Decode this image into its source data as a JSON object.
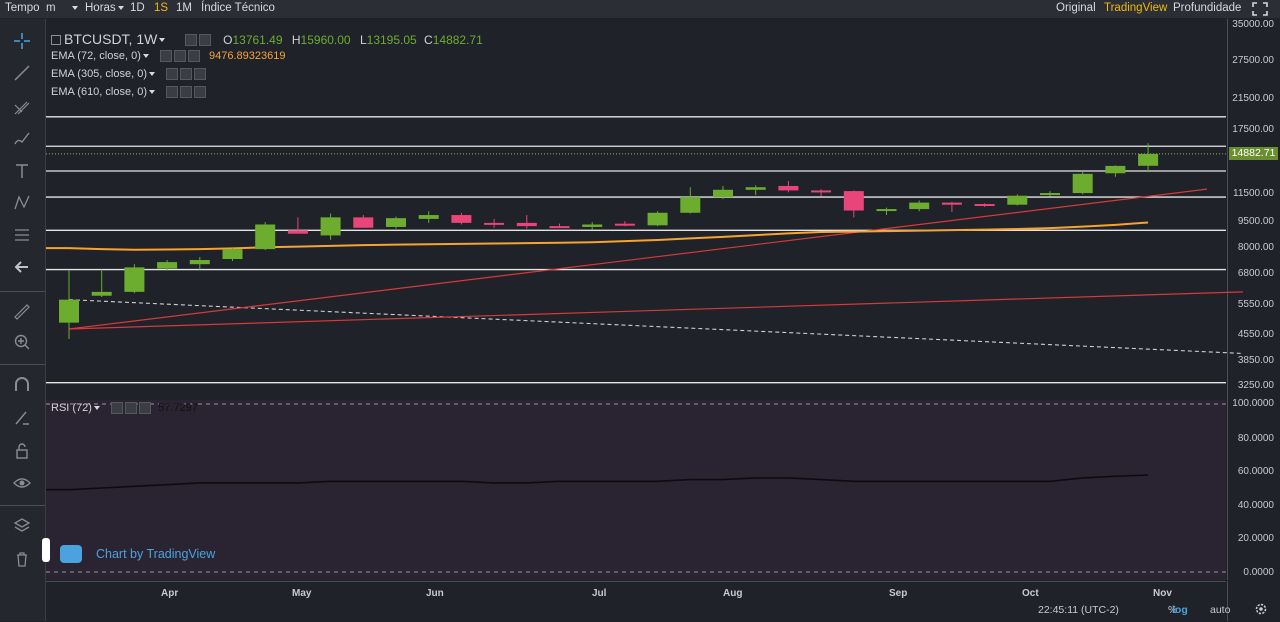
{
  "topbar": {
    "tempo": "Tempo",
    "minutes": "m",
    "hours": "Horas",
    "d1": "1D",
    "s1": "1S",
    "m1": "1M",
    "indicators": "Índice Técnico",
    "original": "Original",
    "tradingview": "TradingView",
    "depth": "Profundidade",
    "active_interval": "1S",
    "active_view": "TradingView"
  },
  "symbol": {
    "name": "BTCUSDT, 1W",
    "open_label": "O",
    "open": "13761.49",
    "high_label": "H",
    "high": "15960.00",
    "low_label": "L",
    "low": "13195.05",
    "close_label": "C",
    "close": "14882.71"
  },
  "indicators": [
    {
      "label": "EMA (72, close, 0)",
      "value": "9476.89323619",
      "color": "#f7a331"
    },
    {
      "label": "EMA (305, close, 0)",
      "value": ""
    },
    {
      "label": "EMA (610, close, 0)",
      "value": ""
    }
  ],
  "rsi": {
    "label": "RSI (72)",
    "value": "57.7297"
  },
  "price_axis": [
    "35000.00",
    "27500.00",
    "21500.00",
    "17500.00",
    "14882.71",
    "11500.00",
    "9500.00",
    "8000.00",
    "6800.00",
    "5550.00",
    "4550.00",
    "3850.00",
    "3250.00"
  ],
  "rsi_axis": [
    "100.0000",
    "80.0000",
    "60.0000",
    "40.0000",
    "20.0000",
    "0.0000"
  ],
  "time_axis": [
    "Apr",
    "May",
    "Jun",
    "Jul",
    "Aug",
    "Sep",
    "Oct",
    "Nov"
  ],
  "status": {
    "time": "22:45:11 (UTC-2)",
    "percent": "%",
    "log": "log",
    "auto": "auto"
  },
  "watermark": "Chart by TradingView",
  "colors": {
    "up": "#6cad2f",
    "down": "#e8457a",
    "ema": "#f7a331",
    "trend": "#d63a3a",
    "accent": "#f0b90b"
  },
  "chart_data": {
    "type": "candlestick",
    "log_scale": true,
    "ylim": [
      3000,
      35000
    ],
    "candles": [
      {
        "o": 4900,
        "h": 6900,
        "l": 4400,
        "c": 5700
      },
      {
        "o": 5850,
        "h": 6950,
        "l": 5800,
        "c": 6000
      },
      {
        "o": 6000,
        "h": 7200,
        "l": 5950,
        "c": 7050
      },
      {
        "o": 7000,
        "h": 7400,
        "l": 6900,
        "c": 7300
      },
      {
        "o": 7200,
        "h": 7550,
        "l": 6950,
        "c": 7400
      },
      {
        "o": 7450,
        "h": 8000,
        "l": 7350,
        "c": 7950
      },
      {
        "o": 7950,
        "h": 9500,
        "l": 7900,
        "c": 9350
      },
      {
        "o": 9000,
        "h": 9800,
        "l": 8800,
        "c": 8800
      },
      {
        "o": 8700,
        "h": 10050,
        "l": 8450,
        "c": 9800
      },
      {
        "o": 9800,
        "h": 9950,
        "l": 9150,
        "c": 9150
      },
      {
        "o": 9200,
        "h": 9850,
        "l": 9100,
        "c": 9750
      },
      {
        "o": 9700,
        "h": 10200,
        "l": 9450,
        "c": 9950
      },
      {
        "o": 9950,
        "h": 10100,
        "l": 9350,
        "c": 9450
      },
      {
        "o": 9450,
        "h": 9700,
        "l": 9150,
        "c": 9400
      },
      {
        "o": 9450,
        "h": 9950,
        "l": 9100,
        "c": 9250
      },
      {
        "o": 9250,
        "h": 9400,
        "l": 9150,
        "c": 9200
      },
      {
        "o": 9200,
        "h": 9500,
        "l": 9050,
        "c": 9350
      },
      {
        "o": 9400,
        "h": 9550,
        "l": 9250,
        "c": 9350
      },
      {
        "o": 9300,
        "h": 10200,
        "l": 9250,
        "c": 10100
      },
      {
        "o": 10100,
        "h": 11950,
        "l": 10050,
        "c": 11200
      },
      {
        "o": 11200,
        "h": 12050,
        "l": 11050,
        "c": 11750
      },
      {
        "o": 11750,
        "h": 12100,
        "l": 11350,
        "c": 11950
      },
      {
        "o": 12050,
        "h": 12450,
        "l": 11550,
        "c": 11700
      },
      {
        "o": 11700,
        "h": 11800,
        "l": 11250,
        "c": 11650
      },
      {
        "o": 11650,
        "h": 11700,
        "l": 9800,
        "c": 10250
      },
      {
        "o": 10250,
        "h": 10450,
        "l": 9950,
        "c": 10350
      },
      {
        "o": 10350,
        "h": 10950,
        "l": 10200,
        "c": 10800
      },
      {
        "o": 10800,
        "h": 10850,
        "l": 10150,
        "c": 10650
      },
      {
        "o": 10700,
        "h": 10750,
        "l": 10500,
        "c": 10600
      },
      {
        "o": 10650,
        "h": 11400,
        "l": 10600,
        "c": 11300
      },
      {
        "o": 11350,
        "h": 11650,
        "l": 11250,
        "c": 11500
      },
      {
        "o": 11500,
        "h": 13200,
        "l": 11400,
        "c": 13050
      },
      {
        "o": 13100,
        "h": 13800,
        "l": 12800,
        "c": 13750
      },
      {
        "o": 13761.49,
        "h": 15960,
        "l": 13195.05,
        "c": 14882.71
      }
    ],
    "ema_72": [
      8000,
      7950,
      7920,
      7930,
      7950,
      7990,
      8050,
      8080,
      8120,
      8160,
      8190,
      8210,
      8230,
      8250,
      8270,
      8290,
      8320,
      8380,
      8440,
      8530,
      8620,
      8720,
      8820,
      8900,
      8920,
      8950,
      8980,
      9010,
      9040,
      9080,
      9130,
      9220,
      9330,
      9476.89
    ],
    "rsi_values": [
      49,
      50,
      51,
      52,
      53,
      53,
      53,
      53,
      54,
      54,
      54,
      54,
      54,
      53,
      53,
      54,
      54,
      54,
      54,
      55,
      55,
      56,
      56,
      55,
      54,
      54,
      54,
      54,
      54,
      54,
      54,
      56,
      57,
      57.7297
    ],
    "horizontal_levels": [
      19000,
      15650,
      13300,
      11200,
      9000,
      6950,
      3300
    ],
    "current_price": 14882.71,
    "trendlines": [
      {
        "color": "#d63a3a",
        "from": [
          0,
          4700
        ],
        "to": [
          34.8,
          11800
        ]
      },
      {
        "color": "#d63a3a",
        "from": [
          0,
          4700
        ],
        "to": [
          35.9,
          6000
        ]
      }
    ],
    "dashed_trendline": {
      "from": [
        0,
        5700
      ],
      "to": [
        35.9,
        4000
      ]
    },
    "rsi_ylim": [
      0,
      100
    ],
    "x_months": [
      "Apr",
      "May",
      "Jun",
      "Jul",
      "Aug",
      "Sep",
      "Oct",
      "Nov"
    ]
  }
}
